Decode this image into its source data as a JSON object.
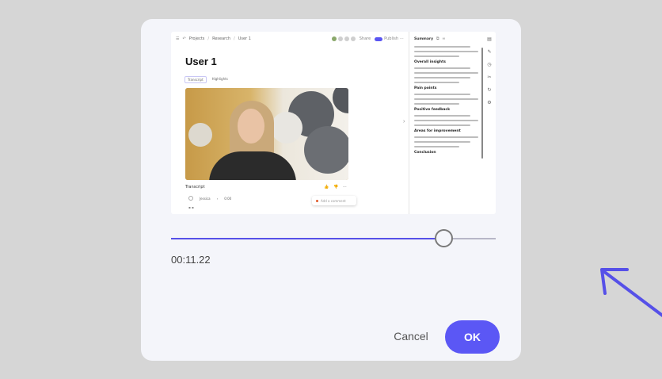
{
  "preview": {
    "toolbar": {
      "crumb1": "Projects",
      "crumb2": "Research",
      "crumb3": "User 1",
      "share": "Share",
      "publish": "Publish"
    },
    "title": "User 1",
    "tags": [
      "Transcript",
      "Highlights"
    ],
    "video_caption": "Transcript",
    "meta_speaker": "Jessica",
    "meta_time": "0:00",
    "float_label": "Add a comment",
    "side": {
      "header": "Summary",
      "headings": [
        "Overall insights",
        "Pain points",
        "Positive feedback",
        "Areas for improvement",
        "Conclusion"
      ]
    }
  },
  "scrubber": {
    "progress": 0.84,
    "time": "00:11.22"
  },
  "buttons": {
    "cancel": "Cancel",
    "ok": "OK"
  },
  "colors": {
    "accent": "#5b57f5",
    "annotation_arrow": "#5650e8"
  }
}
